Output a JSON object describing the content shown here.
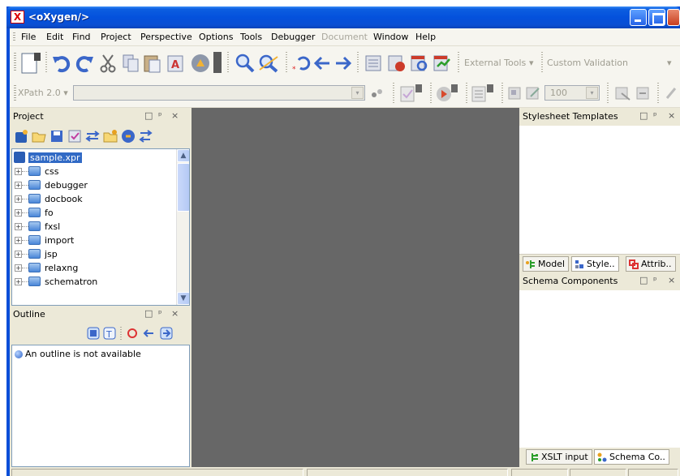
{
  "window": {
    "title": "<oXygen/>",
    "app_icon_letter": "X"
  },
  "menu": {
    "items": [
      {
        "label": "File",
        "enabled": true
      },
      {
        "label": "Edit",
        "enabled": true
      },
      {
        "label": "Find",
        "enabled": true
      },
      {
        "label": "Project",
        "enabled": true
      },
      {
        "label": "Perspective",
        "enabled": true
      },
      {
        "label": "Options",
        "enabled": true
      },
      {
        "label": "Tools",
        "enabled": true
      },
      {
        "label": "Debugger",
        "enabled": true
      },
      {
        "label": "Document",
        "enabled": false
      },
      {
        "label": "Window",
        "enabled": true
      },
      {
        "label": "Help",
        "enabled": true
      }
    ]
  },
  "toolbar": {
    "external_tools": "External Tools",
    "custom_validation": "Custom Validation",
    "dropdown_arrow": "▾"
  },
  "xpath_bar": {
    "version_label": "XPath 2.0",
    "dropdown_arrow": "▾",
    "zoom_value": "100"
  },
  "project_panel": {
    "title": "Project",
    "root": "sample.xpr",
    "folders": [
      "css",
      "debugger",
      "docbook",
      "fo",
      "fxsl",
      "import",
      "jsp",
      "relaxng",
      "schematron"
    ],
    "expander": "+"
  },
  "outline_panel": {
    "title": "Outline",
    "message": "An outline is not available"
  },
  "panel_controls": {
    "restore": "□",
    "pin": "ᵖ",
    "close": "×"
  },
  "templates_panel": {
    "title": "Stylesheet Templates"
  },
  "tabs_top": [
    {
      "label": "Model",
      "active": false
    },
    {
      "label": "Style..",
      "active": true
    },
    {
      "label": "Attrib..",
      "active": false
    }
  ],
  "schema_panel": {
    "title": "Schema Components"
  },
  "tabs_bottom": [
    {
      "label": "XSLT input",
      "active": false
    },
    {
      "label": "Schema Co..",
      "active": true
    }
  ],
  "scrollbar": {
    "up": "▲",
    "down": "▼"
  },
  "colors": {
    "titlebar": "#0a4ed8",
    "editor_bg": "#676767",
    "selection": "#316ac5"
  }
}
